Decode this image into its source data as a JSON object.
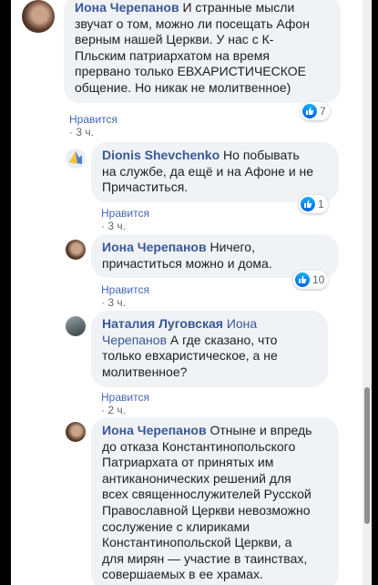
{
  "comments": [
    {
      "author": "Иона Черепанов",
      "lines": [
        "И странные мысли",
        "звучат о том, можно ли посещать Афон",
        "верным нашей Церкви. У нас с К-",
        "Пльским патриархатом на время",
        "прервано только ЕВХАРИСТИЧЕСКОЕ",
        "общение. Но никак не молитвенное)"
      ],
      "like_label": "Нравится",
      "time": "3 ч.",
      "reactions": "7"
    },
    {
      "author": "Dionis Shevchenko",
      "lines": [
        "Но побывать",
        "на службе, да ещё и на Афоне и не",
        "Причаститься."
      ],
      "like_label": "Нравится",
      "time": "3 ч.",
      "reactions": "1"
    },
    {
      "author": "Иона Черепанов",
      "lines": [
        "Ничего,",
        "причаститься можно и дома."
      ],
      "like_label": "Нравится",
      "time": "3 ч.",
      "reactions": "10"
    },
    {
      "author": "Наталия Луговская",
      "mention": "Иона",
      "lines": [
        "Черепанов",
        "А где сказано, что",
        "только евхаристическое, а не",
        "молитвенное?"
      ],
      "like_label": "Нравится",
      "time": "2 ч."
    },
    {
      "author": "Иона Черепанов",
      "lines": [
        "Отныне и впредь",
        "до отказа Константинопольского",
        "Патриархата от принятых им",
        "антиканонических решений для",
        "всех священнослужителей Русской",
        "Православной Церкви невозможно",
        "сослужение с клириками",
        "Константинопольской Церкви, а",
        "для мирян — участие в таинствах,",
        "совершаемых в ее храмах."
      ]
    }
  ],
  "separator": "·",
  "colors": {
    "link": "#385898",
    "bubble": "#f0f2f5",
    "meta": "#606770"
  },
  "icons": {
    "reaction": "thumbs-up-icon"
  }
}
